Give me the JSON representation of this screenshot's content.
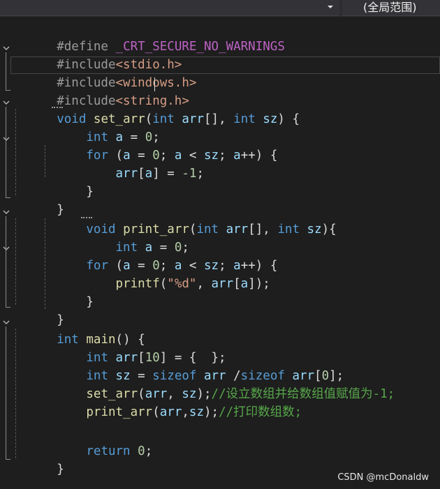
{
  "toolbar": {
    "member_dropdown_value": "",
    "scope_label": "(全局范围)"
  },
  "code": {
    "l1": [
      "#define",
      " ",
      "_CRT_SECURE_NO_WARNINGS"
    ],
    "l2": [
      "#include",
      "<stdio.h>"
    ],
    "l3": [
      "#include",
      "<windows.h>"
    ],
    "l4": [
      "#include",
      "<string.h>"
    ],
    "l5": [
      "void",
      " ",
      "set_arr",
      "(",
      "int",
      " ",
      "arr",
      "[], ",
      "int",
      " ",
      "sz",
      ") {"
    ],
    "l6": [
      "    ",
      "int",
      " ",
      "a",
      " = ",
      "0",
      ";"
    ],
    "l7": [
      "    ",
      "for",
      " (",
      "a",
      " = ",
      "0",
      "; ",
      "a",
      " < ",
      "sz",
      "; ",
      "a",
      "++) {"
    ],
    "l8": [
      "        ",
      "arr",
      "[",
      "a",
      "] = ",
      "-1",
      ";"
    ],
    "l9": [
      "    ",
      "}"
    ],
    "l10": [
      "}"
    ],
    "l11": [
      "    ",
      "void",
      " ",
      "print_arr",
      "(",
      "int",
      " ",
      "arr",
      "[], ",
      "int",
      " ",
      "sz",
      "){"
    ],
    "l12": [
      "        ",
      "int",
      " ",
      "a",
      " = ",
      "0",
      ";"
    ],
    "l13": [
      "    ",
      "for",
      " (",
      "a",
      " = ",
      "0",
      "; ",
      "a",
      " < ",
      "sz",
      "; ",
      "a",
      "++) {"
    ],
    "l14": [
      "        ",
      "printf",
      "(",
      "\"%d\"",
      ", ",
      "arr",
      "[",
      "a",
      "]);"
    ],
    "l15": [
      "    ",
      "}"
    ],
    "l16": [
      "}"
    ],
    "l17": [
      "int",
      " ",
      "main",
      "() {"
    ],
    "l18": [
      "    ",
      "int",
      " ",
      "arr",
      "[",
      "10",
      "] = {  };"
    ],
    "l19": [
      "    ",
      "int",
      " ",
      "sz",
      " = ",
      "sizeof",
      " ",
      "arr",
      " /",
      "sizeof",
      " ",
      "arr",
      "[",
      "0",
      "];"
    ],
    "l20": [
      "    ",
      "set_arr",
      "(",
      "arr",
      ", ",
      "sz",
      ");",
      "//设立数组并给数组值赋值为-1;"
    ],
    "l21": [
      "    ",
      "print_arr",
      "(",
      "arr",
      ",",
      "sz",
      ");",
      "//打印数组数;"
    ],
    "l22": [
      ""
    ],
    "l23": [
      "    ",
      "return",
      " ",
      "0",
      ";"
    ],
    "l24": [
      "}"
    ]
  },
  "watermark": "CSDN @mcDonaldw",
  "colors": {
    "background": "#1e1e1e",
    "keyword": "#569cd6",
    "preprocessor": "#9b9b9b",
    "include_path": "#d69d85",
    "function": "#dcdcaa",
    "variable": "#9cdcfe",
    "number": "#b5cea8",
    "string": "#d69d85",
    "comment": "#57a64a",
    "macro": "#bd63c5",
    "text": "#dcdcdc"
  },
  "icons": {
    "dropdown": "chevron-down-icon",
    "fold": "fold-chevron-icon"
  }
}
